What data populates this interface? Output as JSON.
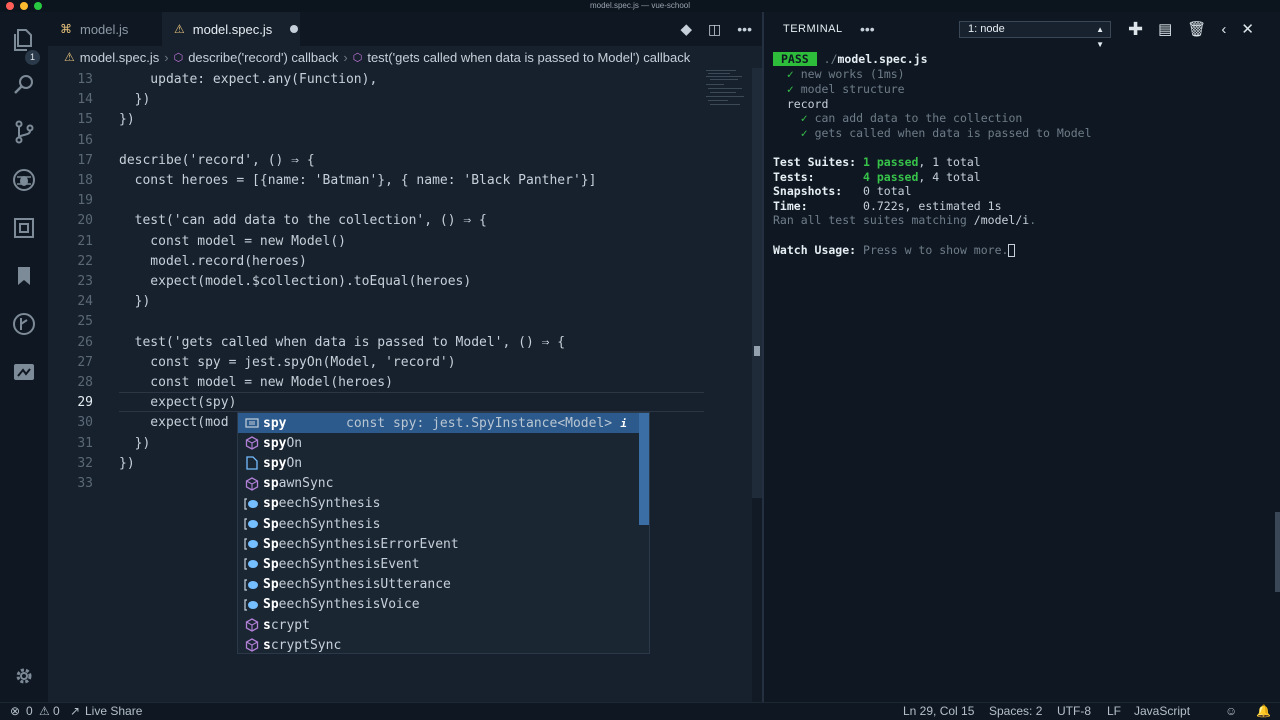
{
  "window": {
    "title": "model.spec.js — vue-school"
  },
  "activity_bar": {
    "scm_badge": "1"
  },
  "tabs": [
    {
      "label": "model.js",
      "active": false
    },
    {
      "label": "model.spec.js",
      "active": true,
      "dirty": true
    }
  ],
  "breadcrumbs": [
    "model.spec.js",
    "describe('record') callback",
    "test('gets called when data is passed to Model') callback"
  ],
  "editor": {
    "current_line": 29,
    "lines": [
      {
        "n": "13",
        "text": "    update: expect.any(Function),"
      },
      {
        "n": "14",
        "text": "  })"
      },
      {
        "n": "15",
        "text": "})"
      },
      {
        "n": "16",
        "text": ""
      },
      {
        "n": "17",
        "text": "describe('record', () ⇒ {"
      },
      {
        "n": "18",
        "text": "  const heroes = [{name: 'Batman'}, { name: 'Black Panther'}]"
      },
      {
        "n": "19",
        "text": ""
      },
      {
        "n": "20",
        "text": "  test('can add data to the collection', () ⇒ {"
      },
      {
        "n": "21",
        "text": "    const model = new Model()"
      },
      {
        "n": "22",
        "text": "    model.record(heroes)"
      },
      {
        "n": "23",
        "text": "    expect(model.$collection).toEqual(heroes)"
      },
      {
        "n": "24",
        "text": "  })"
      },
      {
        "n": "25",
        "text": ""
      },
      {
        "n": "26",
        "text": "  test('gets called when data is passed to Model', () ⇒ {"
      },
      {
        "n": "27",
        "text": "    const spy = jest.spyOn(Model, 'record')"
      },
      {
        "n": "28",
        "text": "    const model = new Model(heroes)"
      },
      {
        "n": "29",
        "text": "    expect(spy)"
      },
      {
        "n": "30",
        "text": "    expect(mod"
      },
      {
        "n": "31",
        "text": "  })"
      },
      {
        "n": "32",
        "text": "})"
      },
      {
        "n": "33",
        "text": ""
      }
    ]
  },
  "suggest": {
    "detail": "const spy: jest.SpyInstance<Model>",
    "info_icon": "i",
    "items": [
      {
        "match": "spy",
        "rest": "",
        "icon": "variable-icon",
        "selected": true
      },
      {
        "match": "spy",
        "rest": "On",
        "icon": "method-icon"
      },
      {
        "match": "spy",
        "rest": "On",
        "icon": "file-icon"
      },
      {
        "match": "sp",
        "rest": "awnSync",
        "icon": "method-icon"
      },
      {
        "match": "sp",
        "rest": "eechSynthesis",
        "icon": "interface-icon"
      },
      {
        "match": "Sp",
        "rest": "eechSynthesis",
        "icon": "interface-icon"
      },
      {
        "match": "Sp",
        "rest": "eechSynthesisErrorEvent",
        "icon": "interface-icon"
      },
      {
        "match": "Sp",
        "rest": "eechSynthesisEvent",
        "icon": "interface-icon"
      },
      {
        "match": "Sp",
        "rest": "eechSynthesisUtterance",
        "icon": "interface-icon"
      },
      {
        "match": "Sp",
        "rest": "eechSynthesisVoice",
        "icon": "interface-icon"
      },
      {
        "match": "s",
        "rest": "crypt",
        "icon": "method-icon"
      },
      {
        "match": "s",
        "rest": "cryptSync",
        "icon": "method-icon"
      }
    ]
  },
  "terminal": {
    "title": "TERMINAL",
    "more": "•••",
    "selected_shell": "1: node",
    "pass_badge": "PASS",
    "file_dir": "./",
    "file_name": "model.spec.js",
    "tests": [
      {
        "check": "✓",
        "name": "new works (1ms)"
      },
      {
        "check": "✓",
        "name": "model structure"
      }
    ],
    "group": "record",
    "group_tests": [
      {
        "check": "✓",
        "name": "can add data to the collection"
      },
      {
        "check": "✓",
        "name": "gets called when data is passed to Model"
      }
    ],
    "summary": {
      "suites_label": "Test Suites:",
      "suites_passed": "1 passed",
      "suites_total": ", 1 total",
      "tests_label": "Tests:",
      "tests_passed": "4 passed",
      "tests_total": ", 4 total",
      "snapshots_label": "Snapshots:",
      "snapshots_value": "0 total",
      "time_label": "Time:",
      "time_value": "0.722s, estimated 1s",
      "ran_text": "Ran all test suites matching ",
      "ran_pattern": "/model/i",
      "ran_end": "."
    },
    "watch_label": "Watch Usage:",
    "watch_hint": "Press w to show more."
  },
  "status_bar": {
    "errors": "0",
    "warnings": "0",
    "live_share": "Live Share",
    "position": "Ln 29, Col 15",
    "spaces": "Spaces: 2",
    "encoding": "UTF-8",
    "eol": "LF",
    "language": "JavaScript"
  }
}
